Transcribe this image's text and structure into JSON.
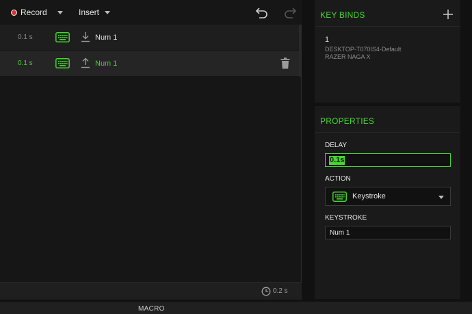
{
  "toolbar": {
    "record_label": "Record",
    "insert_label": "Insert",
    "undo_icon": "undo-icon",
    "redo_icon": "redo-icon"
  },
  "macro_rows": [
    {
      "delay": "0.1 s",
      "device_icon": "keyboard-icon",
      "direction": "key-down",
      "key": "Num 1",
      "selected": false
    },
    {
      "delay": "0.1 s",
      "device_icon": "keyboard-icon",
      "direction": "key-up",
      "key": "Num 1",
      "selected": true
    }
  ],
  "editor_footer": {
    "total_time": "0.2 s"
  },
  "key_binds": {
    "title": "KEY BINDS",
    "items": [
      {
        "key": "1",
        "profile": "DESKTOP-T070IS4-Default",
        "device": "RAZER NAGA X"
      }
    ]
  },
  "properties": {
    "title": "PROPERTIES",
    "delay_label": "DELAY",
    "delay_value": "0.1s",
    "action_label": "ACTION",
    "action_value": "Keystroke",
    "keystroke_label": "KEYSTROKE",
    "keystroke_value": "Num 1"
  },
  "bottom_bar": {
    "tab_label": "MACRO"
  },
  "colors": {
    "accent": "#44d62c",
    "background": "#111111",
    "panel": "#1a1a1a",
    "record": "#e03030"
  }
}
